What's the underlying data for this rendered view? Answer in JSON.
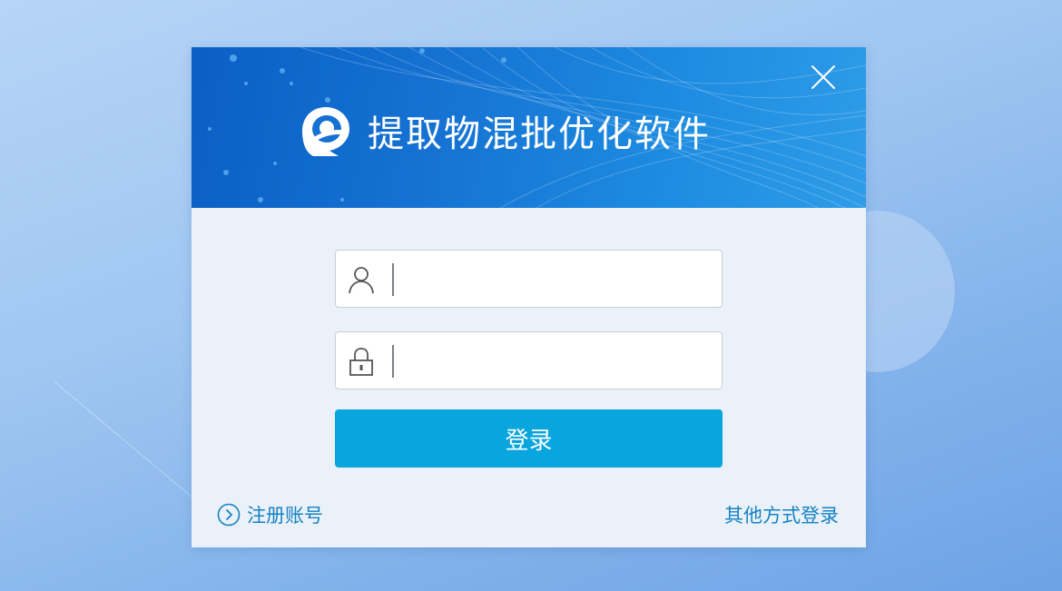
{
  "dialog": {
    "title": "提取物混批优化软件",
    "close_icon": "close-icon",
    "logo_icon": "app-logo"
  },
  "form": {
    "username": {
      "icon": "user-icon",
      "value": "",
      "placeholder": ""
    },
    "password": {
      "icon": "lock-icon",
      "value": "",
      "placeholder": ""
    },
    "login_label": "登录"
  },
  "footer": {
    "register_label": "注册账号",
    "register_icon": "chevron-right-circle-icon",
    "other_login_label": "其他方式登录"
  },
  "colors": {
    "accent": "#08a5de",
    "link": "#1582c3",
    "banner": "#1571d2",
    "panel": "#eaf1f9"
  }
}
